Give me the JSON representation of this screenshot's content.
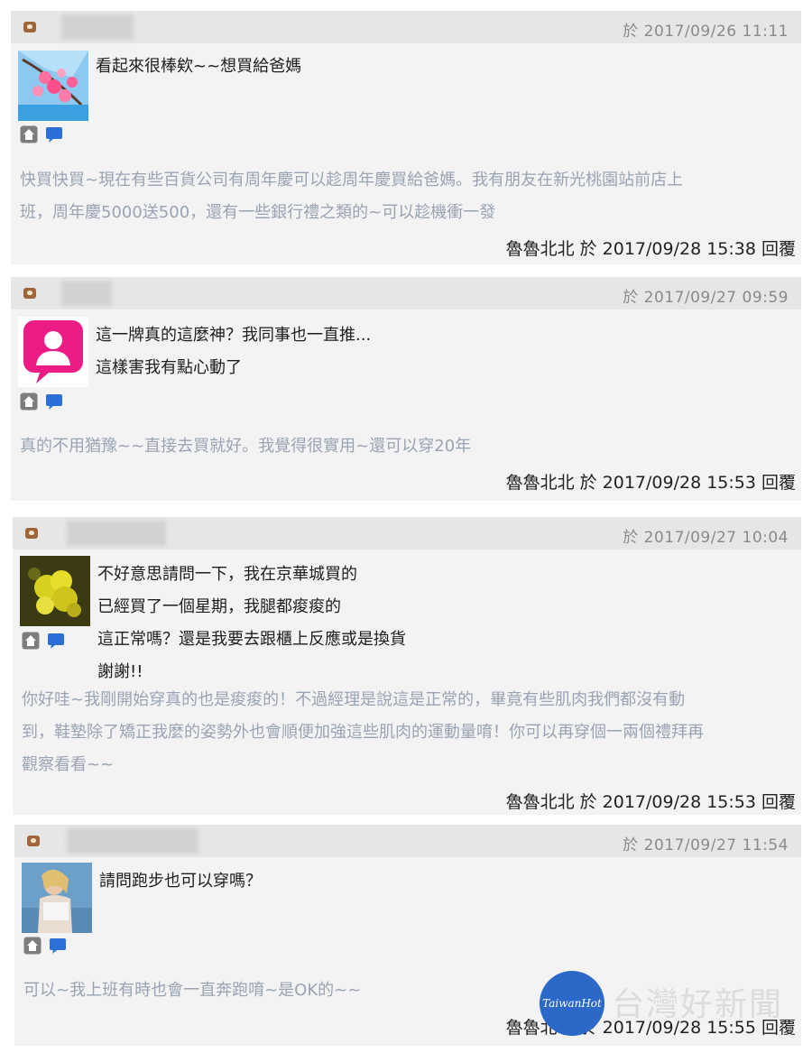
{
  "comments": [
    {
      "date": "於 2017/09/26 11:11",
      "avatar": "flower-photo",
      "lines": [
        "看起來很棒欸~~想買給爸媽"
      ],
      "reply_lines": [
        "快買快買~現在有些百貨公司有周年慶可以趁周年慶買給爸媽。我有朋友在新光桃園站前店上",
        "班，周年慶5000送500，還有一些銀行禮之類的~可以趁機衝一發"
      ],
      "signoff": "魯魯北北 於 2017/09/28 15:38 回覆"
    },
    {
      "date": "於 2017/09/27 09:59",
      "avatar": "default-user",
      "lines": [
        "這一牌真的這麼神？我同事也一直推...",
        "這樣害我有點心動了"
      ],
      "reply_lines": [
        "真的不用猶豫~~直接去買就好。我覺得很實用~還可以穿20年"
      ],
      "signoff": "魯魯北北 於 2017/09/28 15:53 回覆"
    },
    {
      "date": "於 2017/09/27 10:04",
      "avatar": "yellow-flower-photo",
      "lines": [
        "不好意思請問一下，我在京華城買的",
        "已經買了一個星期，我腿都痠痠的",
        "這正常嗎？還是我要去跟櫃上反應或是換貨",
        "謝謝!!"
      ],
      "reply_lines": [
        "你好哇~我剛開始穿真的也是痠痠的！不過經理是說這是正常的，畢竟有些肌肉我們都沒有動",
        "到，鞋墊除了矯正我麼的姿勢外也會順便加強這些肌肉的運動量唷！你可以再穿個一兩個禮拜再",
        "觀察看看~~"
      ],
      "signoff": "魯魯北北 於 2017/09/28 15:53 回覆"
    },
    {
      "date": "於 2017/09/27 11:54",
      "avatar": "person-photo",
      "lines": [
        "請問跑步也可以穿嗎？"
      ],
      "reply_lines": [
        "可以~我上班有時也會一直奔跑唷~是OK的~~"
      ],
      "signoff": "魯魯北北 於 2017/09/28 15:55 回覆"
    }
  ],
  "watermark": {
    "badge": "TaiwanHot",
    "text": "台灣好新聞"
  },
  "colors": {
    "header_bg": "#e6e6e6",
    "body_bg": "#f3f3f3",
    "reply_text": "#9aa3b4",
    "badge_blue": "#2b68c8"
  }
}
